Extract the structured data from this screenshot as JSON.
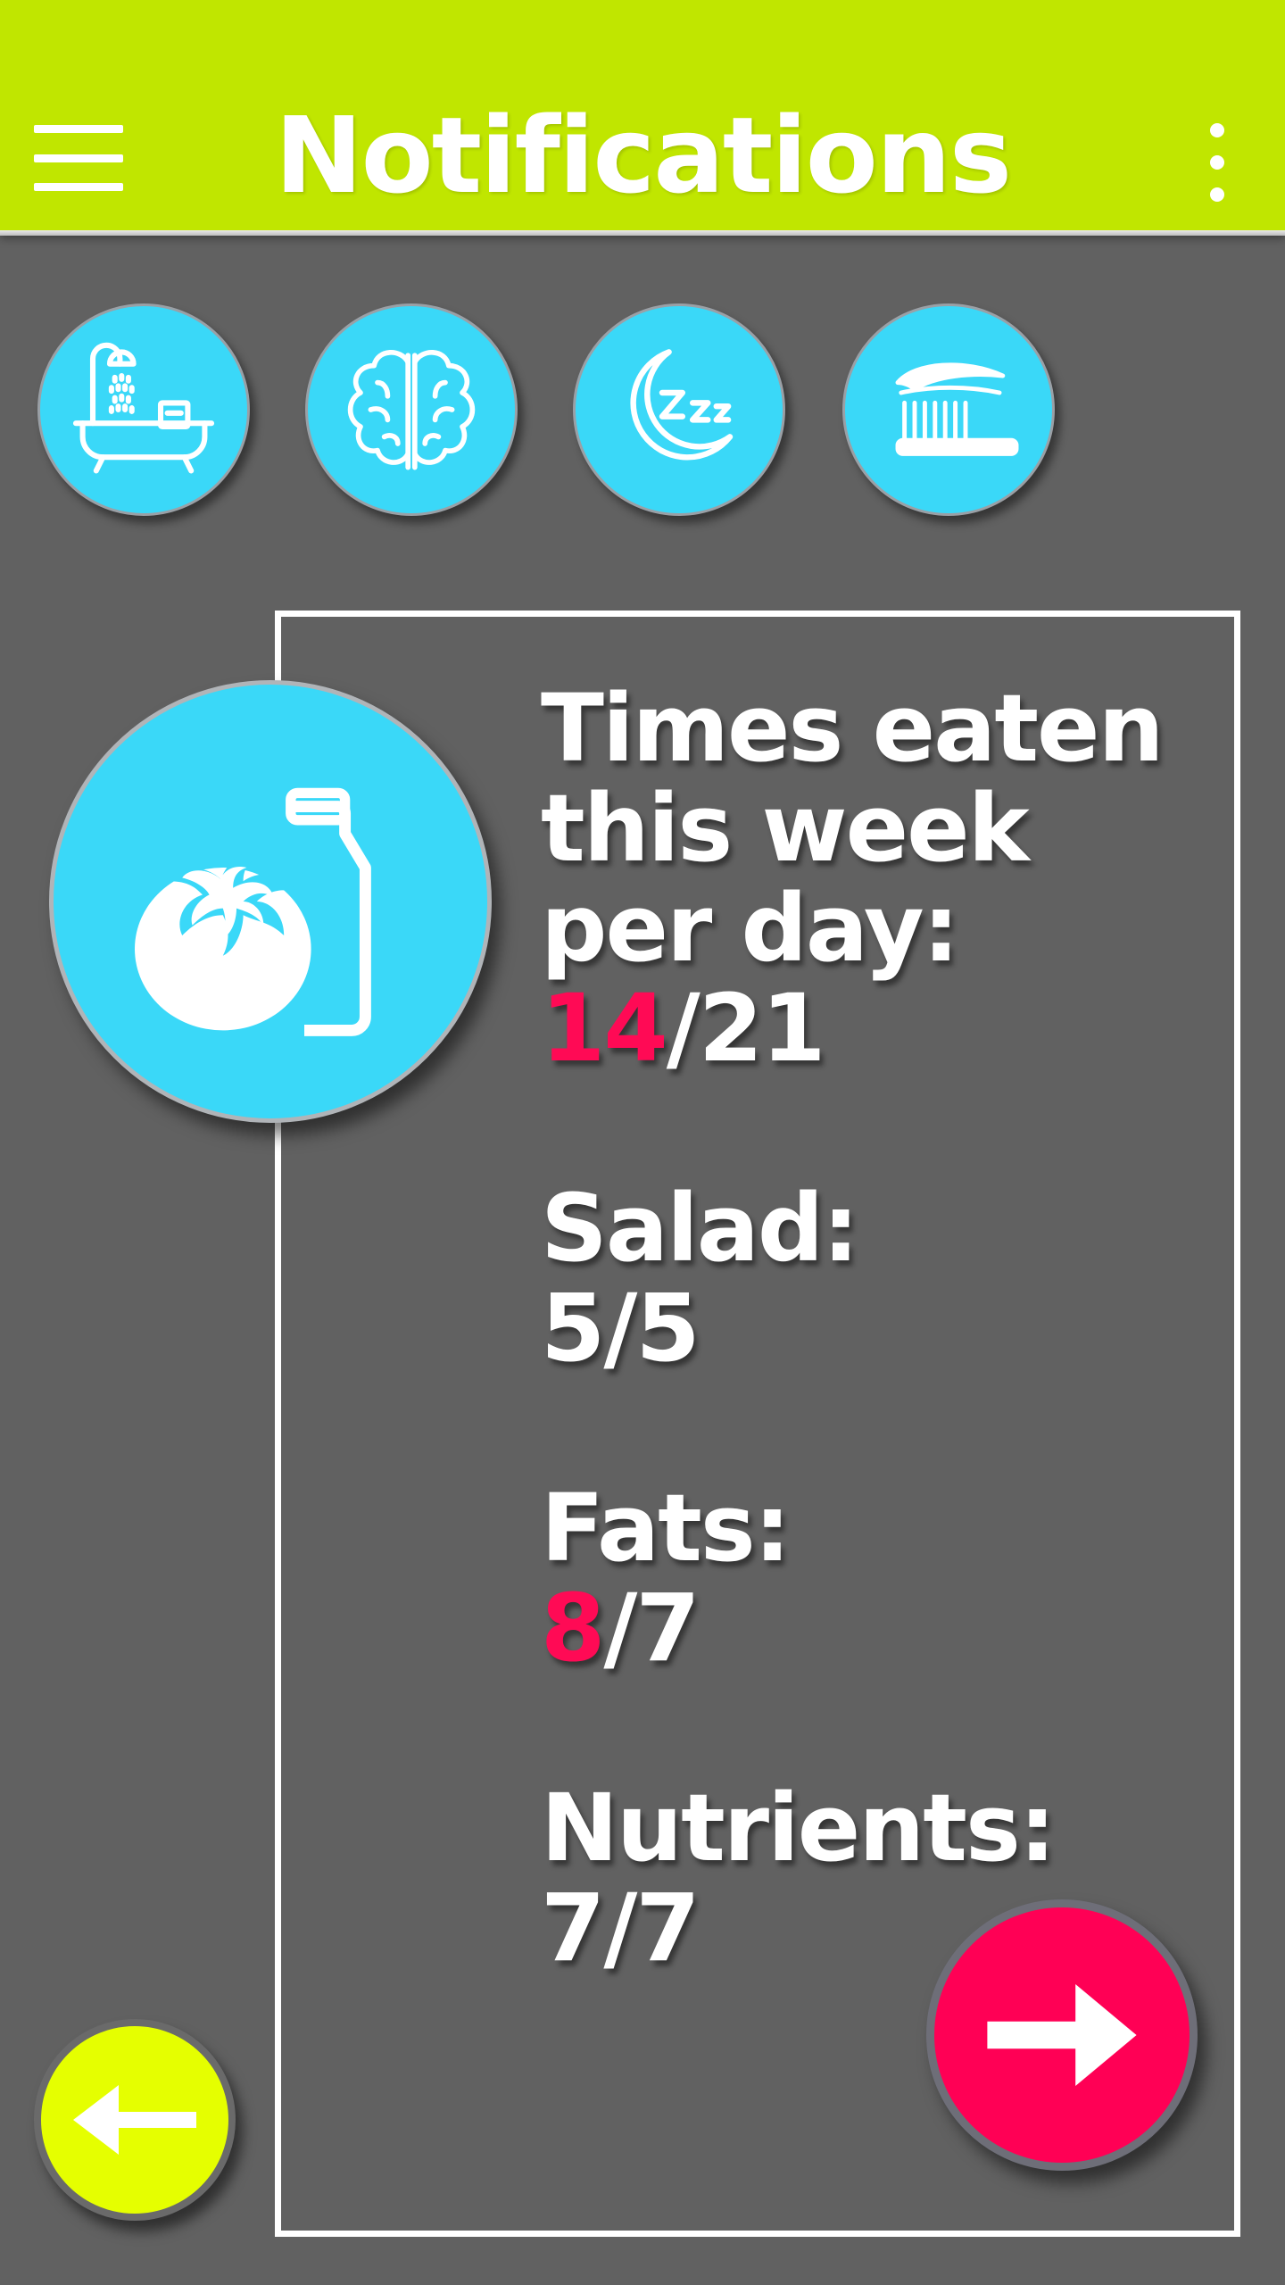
{
  "header": {
    "title": "Notifications",
    "background_color": "#c0e600",
    "menu_icon": "hamburger-menu-icon",
    "overflow_icon": "more-vertical-icon"
  },
  "categories": [
    {
      "name": "hygiene",
      "icon": "bathtub-shower-icon"
    },
    {
      "name": "mind",
      "icon": "brain-icon"
    },
    {
      "name": "sleep",
      "icon": "moon-zzz-icon"
    },
    {
      "name": "dental",
      "icon": "toothbrush-icon"
    }
  ],
  "selected_category": {
    "name": "nutrition",
    "icon": "tomato-bottle-icon"
  },
  "stats": {
    "times_eaten": {
      "label_line1": "Times eaten",
      "label_line2": "this week",
      "label_line3": "per day:",
      "value": "14",
      "total": "/21",
      "over": true
    },
    "salad": {
      "label": "Salad:",
      "value": "5",
      "total": "/5"
    },
    "fats": {
      "label": "Fats:",
      "value": "8",
      "total": "/7",
      "over": true
    },
    "nutrients": {
      "label": "Nutrients:",
      "value": "7",
      "total": "/7"
    }
  },
  "colors": {
    "accent_cyan": "#3ad8f8",
    "alert_pink": "#ff0a55",
    "next_button": "#ff0055",
    "back_button": "#e5ff00",
    "background": "#616161"
  },
  "buttons": {
    "next_icon": "arrow-right-icon",
    "back_icon": "arrow-left-icon"
  }
}
